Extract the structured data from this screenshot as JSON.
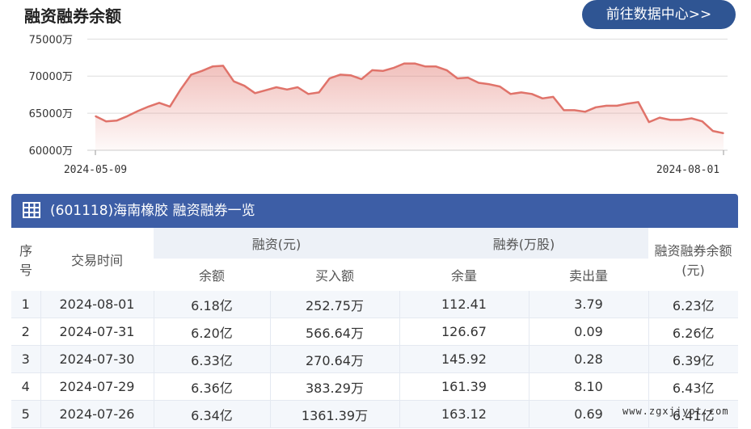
{
  "header": {
    "title": "融资融券余额",
    "center_button": "前往数据中心>>"
  },
  "chart_data": {
    "type": "area",
    "yticks": [
      "75000万",
      "70000万",
      "65000万",
      "60000万"
    ],
    "ytick_values": [
      75000,
      70000,
      65000,
      60000
    ],
    "ylim": [
      60000,
      77000
    ],
    "xticks": [
      "2024-05-09",
      "2024-08-01"
    ],
    "grid": true,
    "color": "#e0736a",
    "series": [
      {
        "values": [
          64600,
          63900,
          64000,
          64600,
          65300,
          65900,
          66400,
          65900,
          68200,
          70200,
          70700,
          71300,
          71400,
          69300,
          68700,
          67700,
          68100,
          68500,
          68200,
          68500,
          67600,
          67800,
          69700,
          70200,
          70100,
          69600,
          70800,
          70700,
          71100,
          71700,
          71700,
          71300,
          71300,
          70800,
          69700,
          69800,
          69100,
          68900,
          68600,
          67600,
          67800,
          67600,
          67000,
          67200,
          65400,
          65400,
          65200,
          65800,
          66000,
          66000,
          66300,
          66500,
          63800,
          64400,
          64100,
          64100,
          64300,
          63900,
          62600,
          62300
        ]
      }
    ]
  },
  "table": {
    "panel_title": "(601118)海南橡胶 融资融券一览",
    "headers": {
      "seq": "序号",
      "date": "交易时间",
      "margin_group": "融资(元)",
      "short_group": "融券(万股)",
      "total": "融资融券余额(元)",
      "margin_balance": "余额",
      "margin_buy": "买入额",
      "short_balance": "余量",
      "short_sell": "卖出量"
    },
    "rows": [
      {
        "seq": "1",
        "date": "2024-08-01",
        "margin_balance": "6.18亿",
        "margin_buy": "252.75万",
        "short_balance": "112.41",
        "short_sell": "3.79",
        "total": "6.23亿"
      },
      {
        "seq": "2",
        "date": "2024-07-31",
        "margin_balance": "6.20亿",
        "margin_buy": "566.64万",
        "short_balance": "126.67",
        "short_sell": "0.09",
        "total": "6.26亿"
      },
      {
        "seq": "3",
        "date": "2024-07-30",
        "margin_balance": "6.33亿",
        "margin_buy": "270.64万",
        "short_balance": "145.92",
        "short_sell": "0.28",
        "total": "6.39亿"
      },
      {
        "seq": "4",
        "date": "2024-07-29",
        "margin_balance": "6.36亿",
        "margin_buy": "383.29万",
        "short_balance": "161.39",
        "short_sell": "8.10",
        "total": "6.43亿"
      },
      {
        "seq": "5",
        "date": "2024-07-26",
        "margin_balance": "6.34亿",
        "margin_buy": "1361.39万",
        "short_balance": "163.12",
        "short_sell": "0.69",
        "total": "6.41亿"
      }
    ]
  },
  "watermark": "www.zgxjjypt.com"
}
